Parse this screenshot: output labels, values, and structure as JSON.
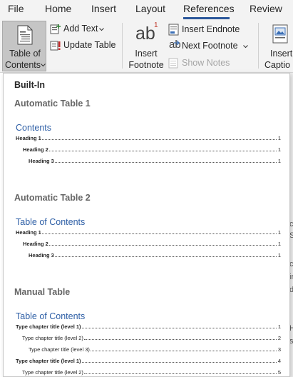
{
  "tabs": [
    {
      "label": "File"
    },
    {
      "label": "Home"
    },
    {
      "label": "Insert"
    },
    {
      "label": "Layout"
    },
    {
      "label": "References"
    },
    {
      "label": "Review"
    }
  ],
  "ribbon": {
    "toc_line1": "Table of",
    "toc_line2": "Contents",
    "add_text": "Add Text",
    "update_table": "Update Table",
    "insert_footnote_line1": "Insert",
    "insert_footnote_line2": "Footnote",
    "footnote_icon_text": "ab",
    "footnote_icon_super": "1",
    "insert_endnote": "Insert Endnote",
    "next_footnote": "Next Footnote",
    "show_notes": "Show Notes",
    "insert_caption_line1": "Insert",
    "insert_caption_line2": "Captio"
  },
  "gallery": {
    "section_header": "Built-In",
    "options": [
      {
        "title": "Automatic Table 1",
        "heading": "Contents",
        "entries": [
          {
            "text": "Heading 1",
            "page": "1"
          },
          {
            "text": "Heading 2",
            "page": "1"
          },
          {
            "text": "Heading 3",
            "page": "1"
          }
        ]
      },
      {
        "title": "Automatic Table 2",
        "heading": "Table of Contents",
        "entries": [
          {
            "text": "Heading 1",
            "page": "1"
          },
          {
            "text": "Heading 2",
            "page": "1"
          },
          {
            "text": "Heading 3",
            "page": "1"
          }
        ]
      },
      {
        "title": "Manual Table",
        "heading": "Table of Contents",
        "entries": [
          {
            "text": "Type chapter title (level 1)",
            "page": "1"
          },
          {
            "text": "Type chapter title (level 2)",
            "page": "2"
          },
          {
            "text": "Type chapter title (level 3)",
            "page": "3"
          },
          {
            "text": "Type chapter title (level 1)",
            "page": "4"
          },
          {
            "text": "Type chapter title (level 2)",
            "page": "5"
          }
        ]
      }
    ]
  },
  "doc_edge": {
    "chars": [
      "c",
      "S",
      "ci",
      "ir",
      "d",
      "H",
      "st"
    ]
  },
  "colors": {
    "accent": "#2b579a",
    "toc_heading": "#2e5fa6",
    "footnote_super": "#c0392b"
  }
}
